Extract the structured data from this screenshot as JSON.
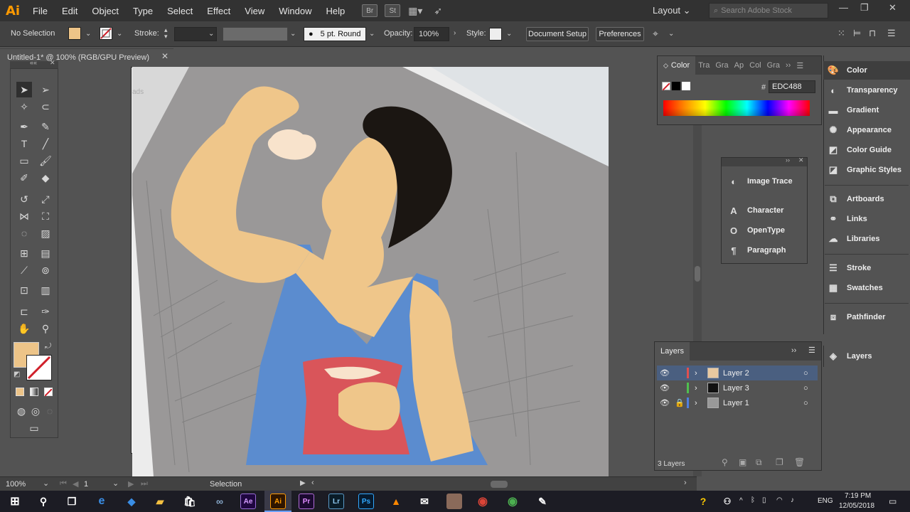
{
  "app": {
    "logo": "Ai",
    "menus": [
      "File",
      "Edit",
      "Object",
      "Type",
      "Select",
      "Effect",
      "View",
      "Window",
      "Help"
    ],
    "bridge_icon": "Br",
    "stock_icon": "St",
    "workspace": "Layout",
    "search_placeholder": "Search Adobe Stock"
  },
  "control_bar": {
    "selection_status": "No Selection",
    "stroke_label": "Stroke:",
    "brush_label": "5 pt. Round",
    "opacity_label": "Opacity:",
    "opacity_value": "100%",
    "style_label": "Style:",
    "document_setup": "Document Setup",
    "preferences": "Preferences"
  },
  "document": {
    "tab_title": "Untitled-1* @ 100% (RGB/GPU Preview)",
    "paper_text": "ads"
  },
  "status_bar": {
    "zoom": "100%",
    "artboard_number": "1",
    "tool_name": "Selection"
  },
  "color_panel": {
    "tabs": [
      "Color",
      "Tra",
      "Gra",
      "Ap",
      "Col",
      "Gra"
    ],
    "hex_symbol": "#",
    "hex_value": "EDC488",
    "fill_color": "#EDC488"
  },
  "floating_panel": {
    "items": [
      "Image Trace",
      "Character",
      "OpenType",
      "Paragraph"
    ]
  },
  "collapsed_panels": {
    "group1": [
      "Color",
      "Transparency",
      "Gradient",
      "Appearance",
      "Color Guide",
      "Graphic Styles"
    ],
    "group2": [
      "Artboards",
      "Links",
      "Libraries"
    ],
    "group3": [
      "Stroke",
      "Swatches"
    ],
    "group4": [
      "Pathfinder"
    ],
    "group5": [
      "Layers"
    ]
  },
  "layers_panel": {
    "title": "Layers",
    "layers": [
      {
        "name": "Layer 2",
        "color": "#e05050",
        "selected": true
      },
      {
        "name": "Layer 3",
        "color": "#4fc04f",
        "selected": false
      },
      {
        "name": "Layer 1",
        "color": "#4f7fe0",
        "selected": false
      }
    ],
    "count": "3 Layers"
  },
  "taskbar": {
    "apps": [
      "Ae",
      "Ai",
      "Pr",
      "Lr",
      "Ps"
    ],
    "language": "ENG",
    "time": "7:19 PM",
    "date": "12/05/2018"
  }
}
